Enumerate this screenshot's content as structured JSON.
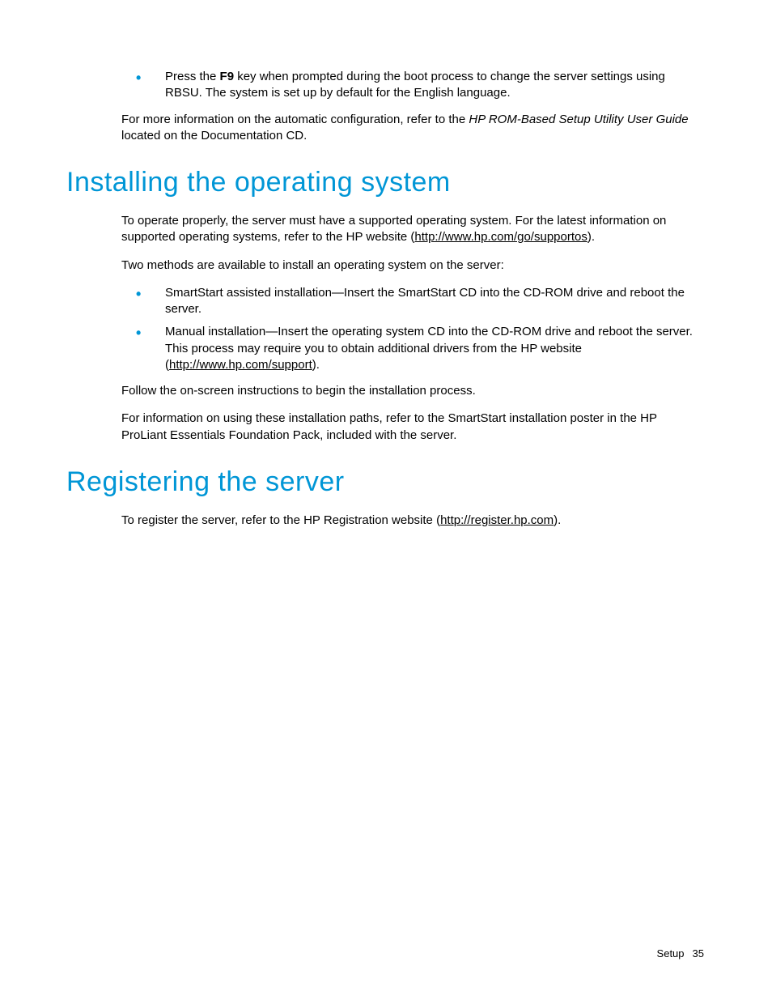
{
  "topBullet": {
    "pre": "Press the ",
    "key": "F9",
    "post": " key when prompted during the boot process to change the server settings using RBSU. The system is set up by default for the English language."
  },
  "topPara": {
    "pre": "For more information on the automatic configuration, refer to the ",
    "em": "HP ROM-Based Setup Utility User Guide",
    "post": " located on the Documentation CD."
  },
  "section1": {
    "heading": "Installing the operating system",
    "p1": {
      "pre": "To operate properly, the server must have a supported operating system. For the latest information on supported operating systems, refer to the HP website (",
      "link": "http://www.hp.com/go/supportos",
      "post": ")."
    },
    "p2": "Two methods are available to install an operating system on the server:",
    "b1": "SmartStart assisted installation—Insert the SmartStart CD into the CD-ROM drive and reboot the server.",
    "b2": {
      "pre": "Manual installation—Insert the operating system CD into the CD-ROM drive and reboot the server. This process may require you to obtain additional drivers from the HP website (",
      "link": "http://www.hp.com/support",
      "post": ")."
    },
    "p3": "Follow the on-screen instructions to begin the installation process.",
    "p4": "For information on using these installation paths, refer to the SmartStart installation poster in the HP ProLiant Essentials Foundation Pack, included with the server."
  },
  "section2": {
    "heading": "Registering the server",
    "p1": {
      "pre": "To register the server, refer to the HP Registration website (",
      "link": "http://register.hp.com",
      "post": ")."
    }
  },
  "footer": {
    "section": "Setup",
    "page": "35"
  }
}
